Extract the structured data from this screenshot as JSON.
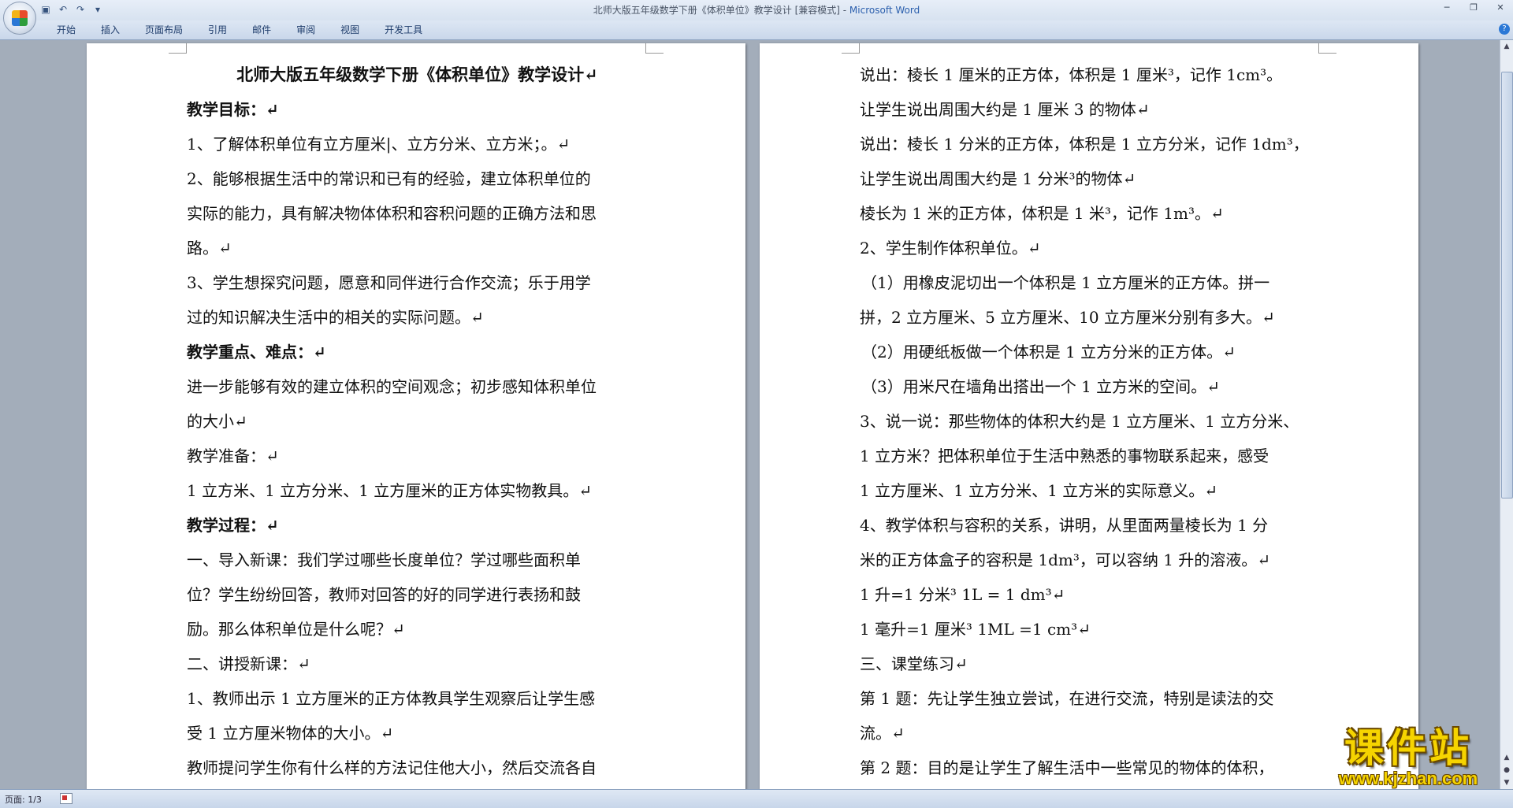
{
  "window": {
    "title": "北师大版五年级数学下册《体积单位》教学设计 [兼容模式] - ",
    "app_name": "Microsoft Word"
  },
  "ribbon": {
    "tabs": [
      "开始",
      "插入",
      "页面布局",
      "引用",
      "邮件",
      "审阅",
      "视图",
      "开发工具"
    ]
  },
  "page1": {
    "lines": [
      "北师大版五年级数学下册《体积单位》教学设计↵",
      "教学目标：↵",
      "1、了解体积单位有立方厘米|、立方分米、立方米；。↵",
      "2、能够根据生活中的常识和已有的经验，建立体积单位的",
      "实际的能力，具有解决物体体积和容积问题的正确方法和思",
      "路。↵",
      "3、学生想探究问题，愿意和同伴进行合作交流；乐于用学",
      "过的知识解决生活中的相关的实际问题。↵",
      "教学重点、难点：↵",
      "进一步能够有效的建立体积的空间观念；初步感知体积单位",
      "的大小↵",
      "教学准备：↵",
      "1 立方米、1 立方分米、1 立方厘米的正方体实物教具。↵",
      "教学过程：↵",
      "一、导入新课：我们学过哪些长度单位？学过哪些面积单",
      "位？学生纷纷回答，教师对回答的好的同学进行表扬和鼓",
      "励。那么体积单位是什么呢？↵",
      "二、讲授新课：↵",
      "1、教师出示 1 立方厘米的正方体教具学生观察后让学生感",
      "受 1 立方厘米物体的大小。↵",
      "教师提问学生你有什么样的方法记住他大小，然后交流各自"
    ]
  },
  "page2": {
    "lines": [
      "说出：棱长 1 厘米的正方体，体积是 1 厘米³，记作 1cm³。",
      "让学生说出周围大约是 1 厘米 3 的物体↵",
      "说出：棱长 1 分米的正方体，体积是 1 立方分米，记作 1dm³，",
      "让学生说出周围大约是 1 分米³的物体↵",
      "棱长为 1 米的正方体，体积是 1 米³，记作 1m³。↵",
      "2、学生制作体积单位。↵",
      "（1）用橡皮泥切出一个体积是 1 立方厘米的正方体。拼一",
      "拼，2 立方厘米、5 立方厘米、10 立方厘米分别有多大。↵",
      "（2）用硬纸板做一个体积是 1 立方分米的正方体。↵",
      "（3）用米尺在墙角出搭出一个 1 立方米的空间。↵",
      "3、说一说：那些物体的体积大约是 1 立方厘米、1 立方分米、",
      "1 立方米？把体积单位于生活中熟悉的事物联系起来，感受",
      "1 立方厘米、1 立方分米、1 立方米的实际意义。↵",
      "4、教学体积与容积的关系，讲明，从里面两量棱长为 1 分",
      "米的正方体盒子的容积是 1dm³，可以容纳 1 升的溶液。↵",
      "1 升=1 分米³        1L = 1 dm³↵",
      "1 毫升=1 厘米³       1ML =1 cm³↵",
      "三、课堂练习↵",
      "第 1 题：先让学生独立尝试，在进行交流，特别是读法的交",
      "流。↵",
      "第 2 题：目的是让学生了解生活中一些常见的物体的体积，"
    ]
  },
  "status": {
    "page_indicator": "页面: 1/3"
  },
  "watermark": {
    "main": "课件站",
    "url": "www.kjzhan.com"
  }
}
